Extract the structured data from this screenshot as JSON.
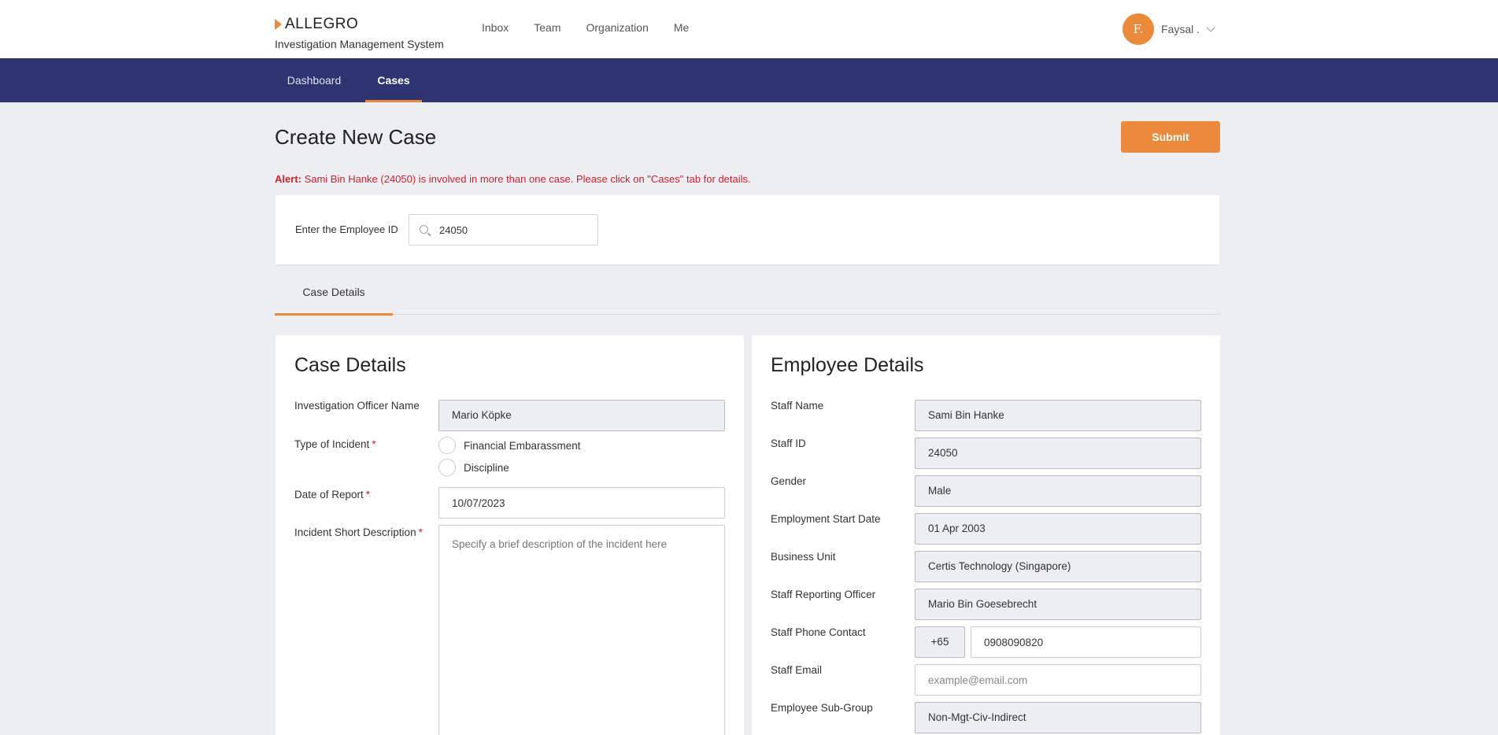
{
  "header": {
    "brand_name": "ALLEGRO",
    "brand_subtitle": "Investigation Management System",
    "nav": [
      "Inbox",
      "Team",
      "Organization",
      "Me"
    ],
    "user": {
      "initials": "F.",
      "name": "Faysal ."
    }
  },
  "navbar": {
    "tabs": [
      "Dashboard",
      "Cases"
    ],
    "active": "Cases"
  },
  "page": {
    "title": "Create New Case",
    "submit_label": "Submit",
    "alert_prefix": "Alert:",
    "alert_text": " Sami Bin Hanke (24050) is involved in more than one case. Please click on \"Cases\" tab for details."
  },
  "search": {
    "label": "Enter the Employee ID",
    "value": "24050"
  },
  "section_tabs": [
    "Case Details"
  ],
  "case_details": {
    "title": "Case Details",
    "officer_label": "Investigation Officer Name",
    "officer_value": "Mario  Köpke",
    "incident_type_label": "Type of Incident",
    "incident_options": [
      "Financial Embarassment",
      "Discipline"
    ],
    "date_label": "Date of Report",
    "date_value": "10/07/2023",
    "description_label": "Incident Short Description",
    "description_placeholder": "Specify a brief description of the incident here",
    "required_mark": "*"
  },
  "employee_details": {
    "title": "Employee Details",
    "staff_name_label": "Staff Name",
    "staff_name": "Sami Bin Hanke",
    "staff_id_label": "Staff ID",
    "staff_id": "24050",
    "gender_label": "Gender",
    "gender": "Male",
    "start_date_label": "Employment Start Date",
    "start_date": "01 Apr 2003",
    "business_unit_label": "Business Unit",
    "business_unit": "Certis Technology (Singapore)",
    "reporting_officer_label": "Staff Reporting Officer",
    "reporting_officer": "Mario Bin Goesebrecht",
    "phone_label": "Staff Phone Contact",
    "phone_code": "+65",
    "phone": "0908090820",
    "email_label": "Staff Email",
    "email_placeholder": "example@email.com",
    "subgroup_label": "Employee Sub-Group",
    "subgroup": "Non-Mgt-Civ-Indirect"
  },
  "colors": {
    "accent": "#ea8a3a",
    "navbar": "#2d3470",
    "alert": "#d0202e"
  }
}
